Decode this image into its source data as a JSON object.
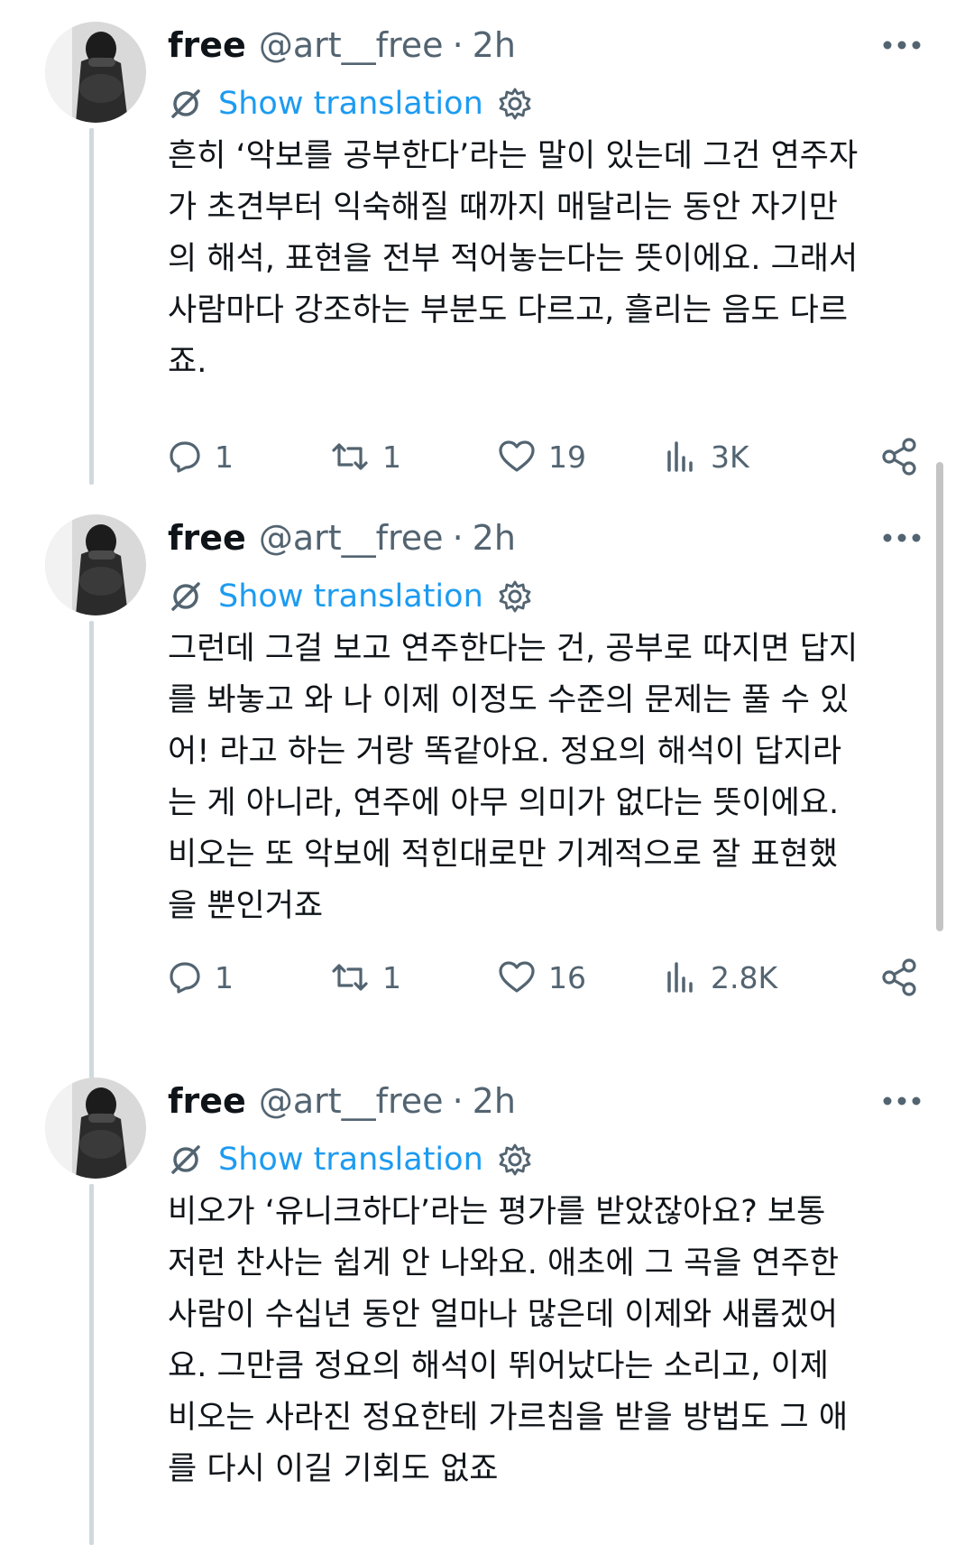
{
  "colors": {
    "text": "#0f1419",
    "secondary": "#536471",
    "link": "#1d9bf0",
    "thread_line": "#cfd9de"
  },
  "icons": [
    "more-icon",
    "translate-icon",
    "settings-gear-icon",
    "reply-icon",
    "retweet-icon",
    "like-icon",
    "views-icon",
    "share-icon"
  ],
  "tweets": [
    {
      "name": "free",
      "handle": "@art__free",
      "separator": "·",
      "time": "2h",
      "translate_label": "Show translation",
      "text_lines": [
        "흔히 ‘악보를 공부한다’라는 말이 있는데 그건 연주자",
        "가 초견부터 익숙해질 때까지 매달리는 동안 자기만",
        "의 해석, 표현을 전부 적어놓는다는 뜻이에요. 그래서",
        "사람마다 강조하는 부분도 다르고, 흘리는 음도 다르",
        "죠."
      ],
      "replies": "1",
      "retweets": "1",
      "likes": "19",
      "views": "3K"
    },
    {
      "name": "free",
      "handle": "@art__free",
      "separator": "·",
      "time": "2h",
      "translate_label": "Show translation",
      "text_lines": [
        "그런데 그걸 보고 연주한다는 건, 공부로 따지면 답지",
        "를 봐놓고 와 나 이제 이정도 수준의 문제는 풀 수 있",
        "어! 라고 하는 거랑 똑같아요. 정요의 해석이 답지라",
        "는 게 아니라, 연주에 아무 의미가 없다는 뜻이에요.",
        "비오는 또 악보에 적힌대로만 기계적으로 잘 표현했",
        "을 뿐인거죠"
      ],
      "replies": "1",
      "retweets": "1",
      "likes": "16",
      "views": "2.8K"
    },
    {
      "name": "free",
      "handle": "@art__free",
      "separator": "·",
      "time": "2h",
      "translate_label": "Show translation",
      "text_lines": [
        "비오가 ‘유니크하다’라는 평가를 받았잖아요? 보통",
        "저런 찬사는 쉽게 안 나와요. 애초에 그 곡을 연주한",
        "사람이 수십년 동안 얼마나 많은데 이제와 새롭겠어",
        "요. 그만큼 정요의 해석이 뛰어났다는 소리고, 이제",
        "비오는 사라진 정요한테 가르침을 받을 방법도 그 애",
        "를 다시 이길 기회도 없죠"
      ]
    }
  ]
}
